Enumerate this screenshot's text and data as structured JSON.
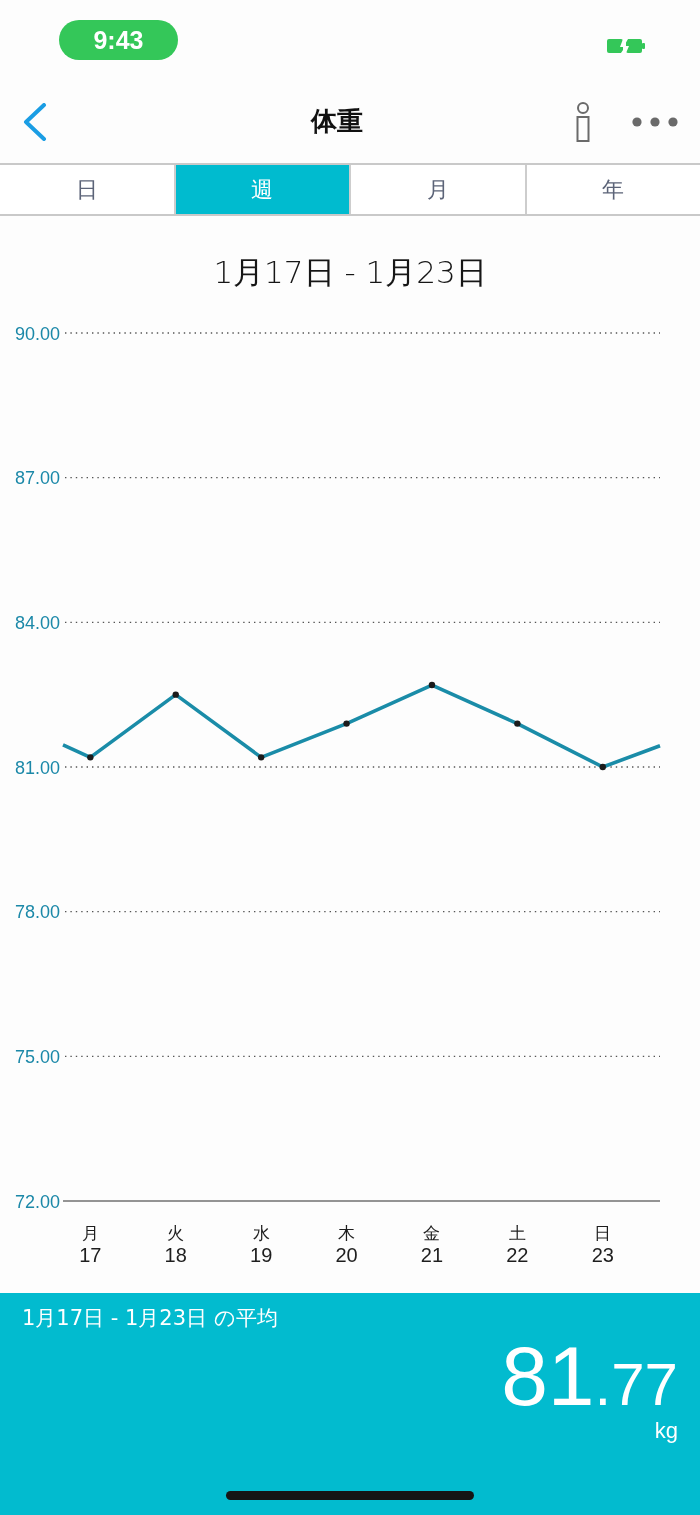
{
  "status_bar": {
    "time": "9:43"
  },
  "nav_bar": {
    "title": "体重"
  },
  "tabs": [
    {
      "label": "日",
      "selected": false
    },
    {
      "label": "週",
      "selected": true
    },
    {
      "label": "月",
      "selected": false
    },
    {
      "label": "年",
      "selected": false
    }
  ],
  "chart": {
    "range_title": "1月17日 - 1月23日",
    "weekday_labels": [
      "月",
      "火",
      "水",
      "木",
      "金",
      "土",
      "日"
    ],
    "chart_data": {
      "type": "line",
      "grid": true,
      "x": [
        16.68,
        17,
        18,
        19,
        20,
        21,
        22,
        23,
        23.67
      ],
      "values": [
        81.46,
        81.2,
        82.5,
        81.2,
        81.9,
        82.7,
        81.9,
        81.0,
        81.44
      ],
      "xlim": [
        16.68,
        23.67
      ],
      "ylim": [
        72,
        90
      ],
      "xticks": [
        {
          "value": 17,
          "label": "17"
        },
        {
          "value": 18,
          "label": "18"
        },
        {
          "value": 19,
          "label": "19"
        },
        {
          "value": 20,
          "label": "20"
        },
        {
          "value": 21,
          "label": "21"
        },
        {
          "value": 22,
          "label": "22"
        },
        {
          "value": 23,
          "label": "23"
        }
      ],
      "yticks": [
        {
          "value": 90,
          "label": "90.00"
        },
        {
          "value": 87,
          "label": "87.00"
        },
        {
          "value": 84,
          "label": "84.00"
        },
        {
          "value": 81,
          "label": "81.00"
        },
        {
          "value": 78,
          "label": "78.00"
        },
        {
          "value": 75,
          "label": "75.00"
        },
        {
          "value": 72,
          "label": "72.00"
        }
      ]
    }
  },
  "summary": {
    "label": "1月17日 - 1月23日 の平均",
    "value_integer": "81",
    "value_fraction": ".77",
    "unit": "kg"
  }
}
